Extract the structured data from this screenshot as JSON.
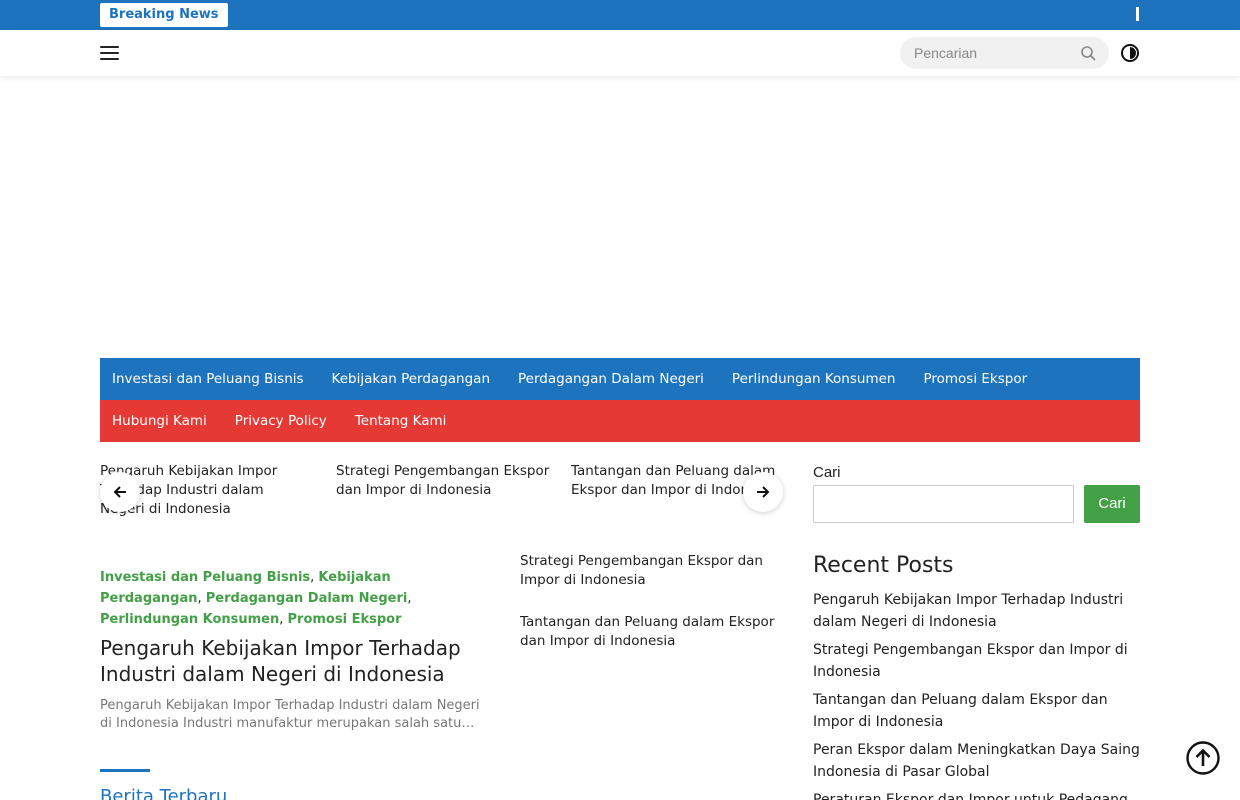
{
  "topbar": {
    "breaking_label": "Breaking News"
  },
  "header": {
    "search_placeholder": "Pencarian"
  },
  "nav": {
    "primary": [
      "Investasi dan Peluang Bisnis",
      "Kebijakan Perdagangan",
      "Perdagangan Dalam Negeri",
      "Perlindungan Konsumen",
      "Promosi Ekspor"
    ],
    "secondary": [
      "Hubungi Kami",
      "Privacy Policy",
      "Tentang Kami"
    ]
  },
  "carousel": {
    "items": [
      "Pengaruh Kebijakan Impor Terhadap Industri dalam Negeri di Indonesia",
      "Strategi Pengembangan Ekspor dan Impor di Indonesia",
      "Tantangan dan Peluang dalam Ekspor dan Impor di Indonesia"
    ]
  },
  "featured": {
    "categories": [
      "Investasi dan Peluang Bisnis",
      "Kebijakan Perdagangan",
      "Perdagangan Dalam Negeri",
      "Perlindungan Konsumen",
      "Promosi Ekspor"
    ],
    "title": "Pengaruh Kebijakan Impor Terhadap Industri dalam Negeri di Indonesia",
    "excerpt": "Pengaruh Kebijakan Impor Terhadap Industri dalam Negeri di Indonesia Industri manufaktur merupakan salah satu sektor…"
  },
  "side_posts": [
    "Strategi Pengembangan Ekspor dan Impor di Indonesia",
    "Tantangan dan Peluang dalam Ekspor dan Impor di Indonesia"
  ],
  "berita_title": "Berita Terbaru",
  "sidebar": {
    "search_label": "Cari",
    "search_button": "Cari",
    "recent_title": "Recent Posts",
    "recent_posts": [
      "Pengaruh Kebijakan Impor Terhadap Industri dalam Negeri di Indonesia",
      "Strategi Pengembangan Ekspor dan Impor di Indonesia",
      "Tantangan dan Peluang dalam Ekspor dan Impor di Indonesia",
      "Peran Ekspor dalam Meningkatkan Daya Saing Indonesia di Pasar Global",
      "Peraturan Ekspor dan Impor untuk Pedagang"
    ]
  },
  "colors": {
    "primary_blue": "#1e73be",
    "secondary_red": "#e53935",
    "accent_green": "#43a047"
  }
}
